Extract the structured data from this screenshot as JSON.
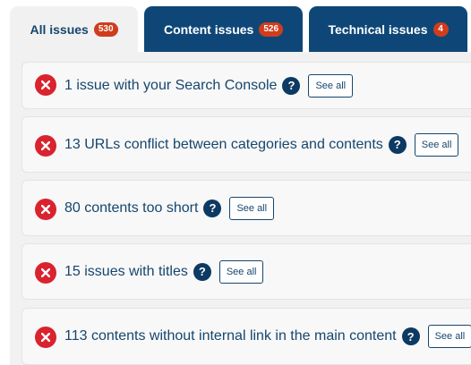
{
  "tabs": [
    {
      "label": "All issues",
      "count": "530",
      "active": true
    },
    {
      "label": "Content issues",
      "count": "526",
      "active": false
    },
    {
      "label": "Technical issues",
      "count": "4",
      "active": false
    }
  ],
  "issues": [
    {
      "text": "1 issue with your Search Console",
      "action": "See all"
    },
    {
      "text": "13 URLs conflict between categories and contents",
      "action": "See all"
    },
    {
      "text": "80 contents too short",
      "action": "See all"
    },
    {
      "text": "15 issues with titles",
      "action": "See all"
    },
    {
      "text": "113 contents without internal link in the main content",
      "action": "See all"
    }
  ],
  "icons": {
    "status": "error-x-icon",
    "help": "question-mark-icon",
    "help_glyph": "?"
  },
  "colors": {
    "tab_dark": "#0e4777",
    "badge": "#cf3d1d",
    "error": "#d9232f",
    "text": "#16466e"
  }
}
